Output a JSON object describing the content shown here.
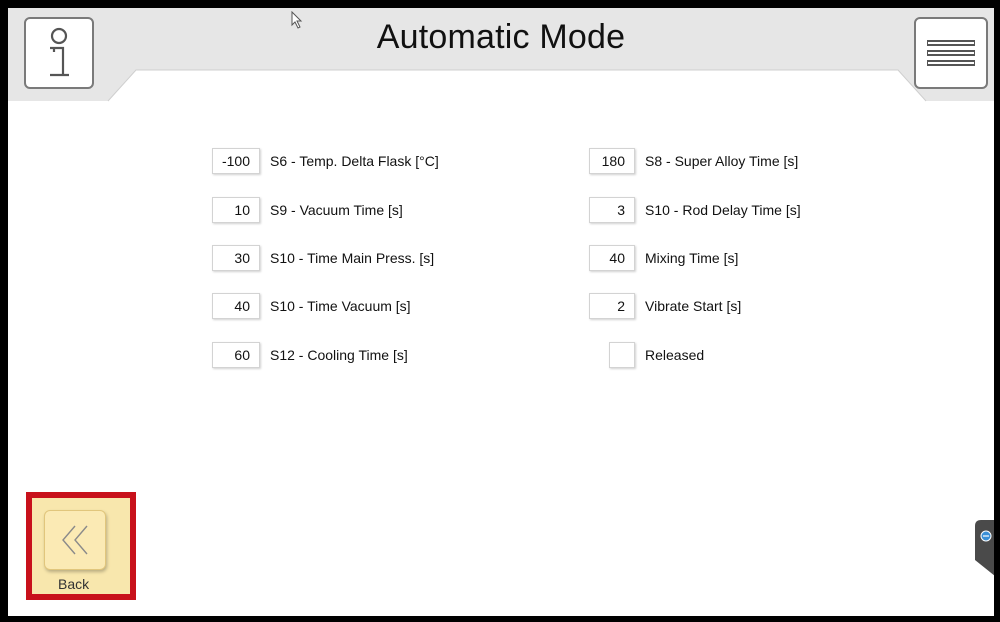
{
  "header": {
    "title": "Automatic Mode",
    "info_icon": "info-icon",
    "menu_icon": "hamburger-menu-icon"
  },
  "parameters_left": [
    {
      "value": "-100",
      "label": "S6 - Temp. Delta Flask [°C]"
    },
    {
      "value": "10",
      "label": "S9 - Vacuum Time [s]"
    },
    {
      "value": "30",
      "label": "S10 - Time Main Press. [s]"
    },
    {
      "value": "40",
      "label": "S10 - Time Vacuum [s]"
    },
    {
      "value": "60",
      "label": "S12 - Cooling Time [s]"
    }
  ],
  "parameters_right": [
    {
      "value": "180",
      "label": "S8 - Super Alloy Time [s]"
    },
    {
      "value": "3",
      "label": "S10 - Rod Delay Time [s]"
    },
    {
      "value": "40",
      "label": "Mixing Time [s]"
    },
    {
      "value": "2",
      "label": "Vibrate Start [s]"
    }
  ],
  "released": {
    "label": "Released",
    "checked": false
  },
  "back": {
    "label": "Back",
    "icon": "double-chevron-left-icon"
  },
  "colors": {
    "highlight_border": "#c8111b",
    "back_fill": "#fbeab4",
    "header_band": "#e5e5e5"
  }
}
